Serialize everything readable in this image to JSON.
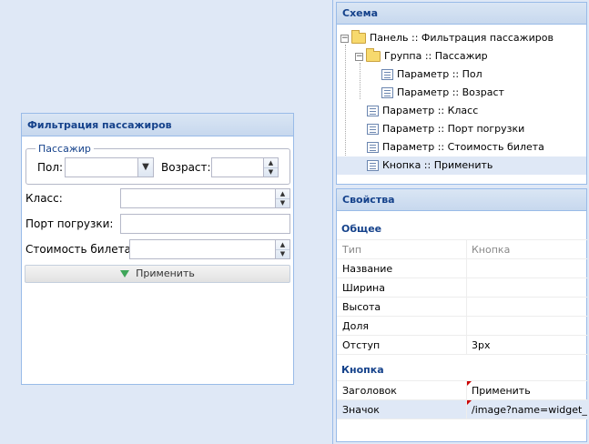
{
  "form": {
    "title": "Фильтрация пассажиров",
    "fieldset_legend": "Пассажир",
    "sex_label": "Пол:",
    "sex_value": "",
    "age_label": "Возраст:",
    "age_value": "",
    "class_label": "Класс:",
    "class_value": "",
    "port_label": "Порт погрузки:",
    "port_value": "",
    "fare_label": "Стоимость билета:",
    "fare_value": "",
    "apply_label": "Применить",
    "apply_icon": "green-triangle-down-icon"
  },
  "schema": {
    "title": "Схема",
    "nodes": [
      {
        "label": "Панель :: Фильтрация пассажиров",
        "type": "folder",
        "expanded": true
      },
      {
        "label": "Группа :: Пассажир",
        "type": "folder",
        "expanded": true
      },
      {
        "label": "Параметр :: Пол",
        "type": "leaf"
      },
      {
        "label": "Параметр :: Возраст",
        "type": "leaf"
      },
      {
        "label": "Параметр :: Класс",
        "type": "leaf"
      },
      {
        "label": "Параметр :: Порт погрузки",
        "type": "leaf"
      },
      {
        "label": "Параметр :: Стоимость билета",
        "type": "leaf"
      },
      {
        "label": "Кнопка :: Применить",
        "type": "leaf",
        "selected": true
      }
    ]
  },
  "properties": {
    "title": "Свойства",
    "general_group": "Общее",
    "general_rows": [
      {
        "name": "Тип",
        "value": "Кнопка",
        "readonly": true
      },
      {
        "name": "Название",
        "value": ""
      },
      {
        "name": "Ширина",
        "value": ""
      },
      {
        "name": "Высота",
        "value": ""
      },
      {
        "name": "Доля",
        "value": ""
      },
      {
        "name": "Отступ",
        "value": "3px"
      }
    ],
    "button_group": "Кнопка",
    "button_rows": [
      {
        "name": "Заголовок",
        "value": "Применить",
        "dirty": true
      },
      {
        "name": "Значок",
        "value": "/image?name=widget_d...",
        "dirty": true,
        "selected": true
      }
    ]
  }
}
